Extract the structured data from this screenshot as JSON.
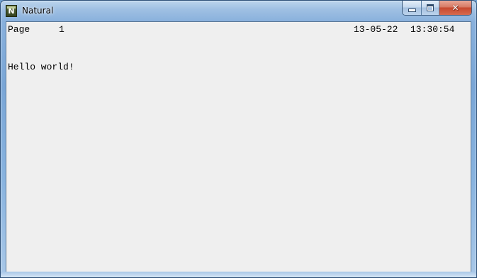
{
  "window": {
    "title": "Natural",
    "icon": "natural-app-icon",
    "icon_letter": "N",
    "controls": {
      "minimize": "minimize-icon",
      "maximize": "maximize-icon",
      "close": "close-icon",
      "close_glyph": "✕"
    }
  },
  "report": {
    "page_label": "Page",
    "page_number": "1",
    "date": "13-05-22",
    "time": "13:30:54",
    "message": "Hello world!"
  },
  "colors": {
    "client_background": "#efefef",
    "text": "#000000",
    "window_frame": "#7aa6d6",
    "close_button": "#c7482e"
  }
}
